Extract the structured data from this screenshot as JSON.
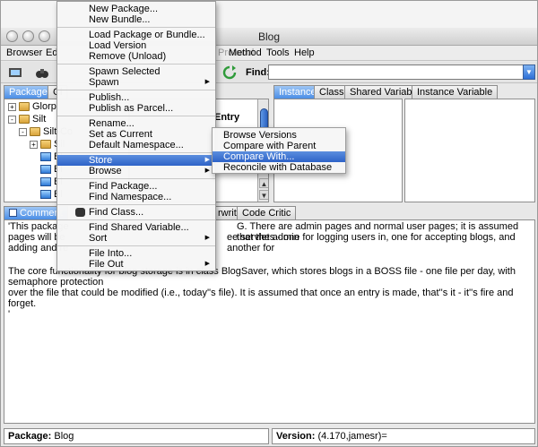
{
  "window": {
    "title": "Blog"
  },
  "menubar": [
    "Browser",
    "Ed",
    "Protocol",
    "Method",
    "Tools",
    "Help"
  ],
  "toolbar": {
    "find_label": "Find:",
    "find_value": ""
  },
  "left_tabs": [
    "Package",
    "Cl"
  ],
  "right_tabs": [
    "Instance",
    "Class",
    "Shared Variable",
    "Instance Variable"
  ],
  "tree": [
    {
      "label": "Glorp",
      "expander": "+"
    },
    {
      "label": "Silt",
      "expander": "-"
    },
    {
      "label": "Silt-Co",
      "expander": "-"
    },
    {
      "label": "Sil",
      "expander": "+"
    },
    {
      "label": "Bl",
      "expander": ""
    },
    {
      "label": "Bl",
      "expander": ""
    },
    {
      "label": "Bl",
      "expander": ""
    },
    {
      "label": "Bl",
      "expander": ""
    }
  ],
  "method_hint": "Entry",
  "bottom_tabs": [
    "Comment",
    "rwrite",
    "Code Critic"
  ],
  "comment": {
    "p1_line1": "'This package",
    "p1_line1b": "G.  There are admin pages and normal user pages; it is assumed that the admin",
    "p1_line2": "pages will be",
    "p1_line2b": "ee servlets - one for logging users in, one for accepting blogs, and another for",
    "p1_line3": "adding and re",
    "p2_line1": "The core functionality for blog storage is in class BlogSaver, which stores blogs in a BOSS file - one file per day, with semaphore protection",
    "p2_line2": "over the file that could be modified (i.e., today''s file).  It is assumed that once an entry is made, that''s it - it''s fire and forget.",
    "p3": "'"
  },
  "status": {
    "package_label": "Package:",
    "package_value": "Blog",
    "version_label": "Version:",
    "version_value": "(4.170,jamesr)="
  },
  "context_menu": [
    {
      "label": "New Package...",
      "type": "item"
    },
    {
      "label": "New Bundle...",
      "type": "item"
    },
    {
      "type": "sep"
    },
    {
      "label": "Load Package or Bundle...",
      "type": "item"
    },
    {
      "label": "Load Version",
      "type": "item"
    },
    {
      "label": "Remove (Unload)",
      "type": "item"
    },
    {
      "type": "sep"
    },
    {
      "label": "Spawn Selected",
      "type": "item"
    },
    {
      "label": "Spawn",
      "type": "sub"
    },
    {
      "type": "sep"
    },
    {
      "label": "Publish...",
      "type": "item"
    },
    {
      "label": "Publish as Parcel...",
      "type": "item"
    },
    {
      "type": "sep"
    },
    {
      "label": "Rename...",
      "type": "item"
    },
    {
      "label": "Set as Current",
      "type": "item"
    },
    {
      "label": "Default Namespace...",
      "type": "item"
    },
    {
      "type": "sep"
    },
    {
      "label": "Store",
      "type": "sub",
      "highlighted": true
    },
    {
      "label": "Browse",
      "type": "sub"
    },
    {
      "type": "sep"
    },
    {
      "label": "Find Package...",
      "type": "item"
    },
    {
      "label": "Find Namespace...",
      "type": "item"
    },
    {
      "type": "sep"
    },
    {
      "label": "Find Class...",
      "type": "item"
    },
    {
      "type": "sep"
    },
    {
      "label": "Find Shared Variable...",
      "type": "item"
    },
    {
      "label": "Sort",
      "type": "sub"
    },
    {
      "type": "sep"
    },
    {
      "label": "File Into...",
      "type": "item"
    },
    {
      "label": "File Out",
      "type": "sub"
    }
  ],
  "store_submenu": [
    {
      "label": "Browse Versions"
    },
    {
      "label": "Compare with Parent"
    },
    {
      "label": "Compare With...",
      "highlighted": true
    },
    {
      "label": "Reconcile with Database"
    }
  ]
}
